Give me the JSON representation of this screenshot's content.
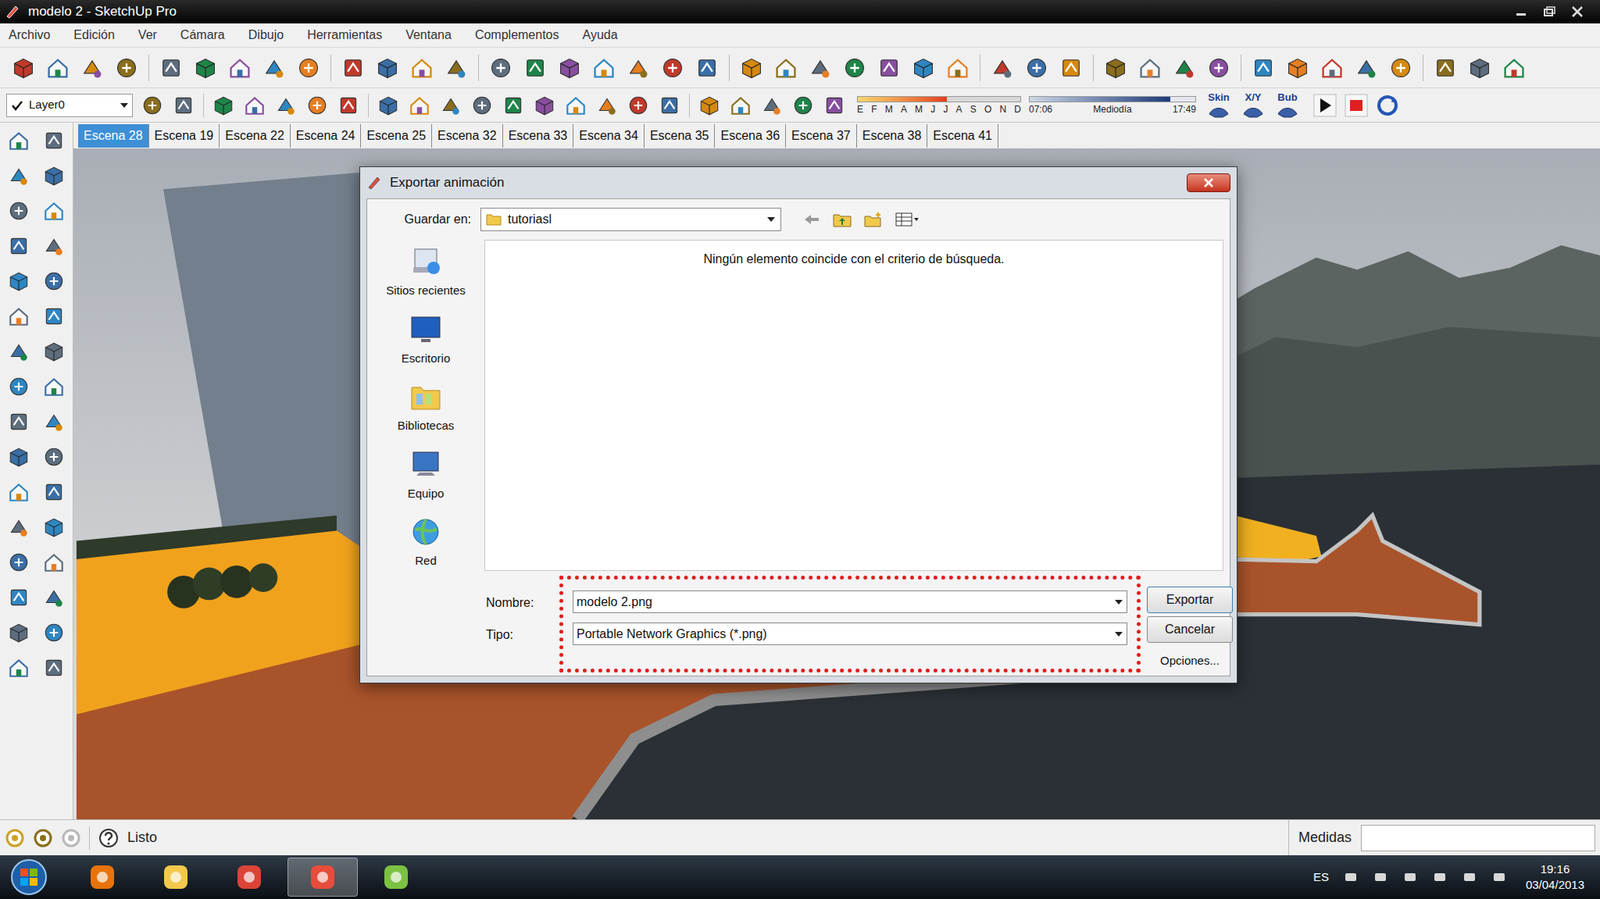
{
  "window": {
    "title": "modelo 2 - SketchUp Pro"
  },
  "menu": [
    "Archivo",
    "Edición",
    "Ver",
    "Cámara",
    "Dibujo",
    "Herramientas",
    "Ventana",
    "Complementos",
    "Ayuda"
  ],
  "toolbar2": {
    "layer": {
      "checked": true,
      "value": "Layer0"
    },
    "date_slider": {
      "months": [
        "E",
        "F",
        "M",
        "A",
        "M",
        "J",
        "J",
        "A",
        "S",
        "O",
        "N",
        "D"
      ],
      "level": 0.55
    },
    "time_slider": {
      "start": "07:06",
      "middle": "Mediodía",
      "end": "17:49",
      "level": 0.85
    },
    "labels": [
      "Skin",
      "X/Y",
      "Bub"
    ]
  },
  "scene_tabs": [
    {
      "label": "Escena 28",
      "selected": true
    },
    {
      "label": "Escena 19",
      "selected": false
    },
    {
      "label": "Escena 22",
      "selected": false
    },
    {
      "label": "Escena 24",
      "selected": false
    },
    {
      "label": "Escena 25",
      "selected": false
    },
    {
      "label": "Escena 32",
      "selected": false
    },
    {
      "label": "Escena 33",
      "selected": false
    },
    {
      "label": "Escena 34",
      "selected": false
    },
    {
      "label": "Escena 35",
      "selected": false
    },
    {
      "label": "Escena 36",
      "selected": false
    },
    {
      "label": "Escena 37",
      "selected": false
    },
    {
      "label": "Escena 38",
      "selected": false
    },
    {
      "label": "Escena 41",
      "selected": false
    }
  ],
  "dialog": {
    "title": "Exportar animación",
    "save_in_label": "Guardar en:",
    "save_in": "tutoriasl",
    "places": [
      "Sitios recientes",
      "Escritorio",
      "Bibliotecas",
      "Equipo",
      "Red"
    ],
    "empty_message": "Ningún elemento coincide con el criterio de búsqueda.",
    "name_label": "Nombre:",
    "name_value": "modelo 2.png",
    "type_label": "Tipo:",
    "type_value": "Portable Network Graphics (*.png)",
    "export": "Exportar",
    "cancel": "Cancelar",
    "options": "Opciones..."
  },
  "status_bar": {
    "text": "Listo",
    "measures_label": "Medidas"
  },
  "taskbar": {
    "language": "ES",
    "time": "19:16",
    "date": "03/04/2013"
  }
}
